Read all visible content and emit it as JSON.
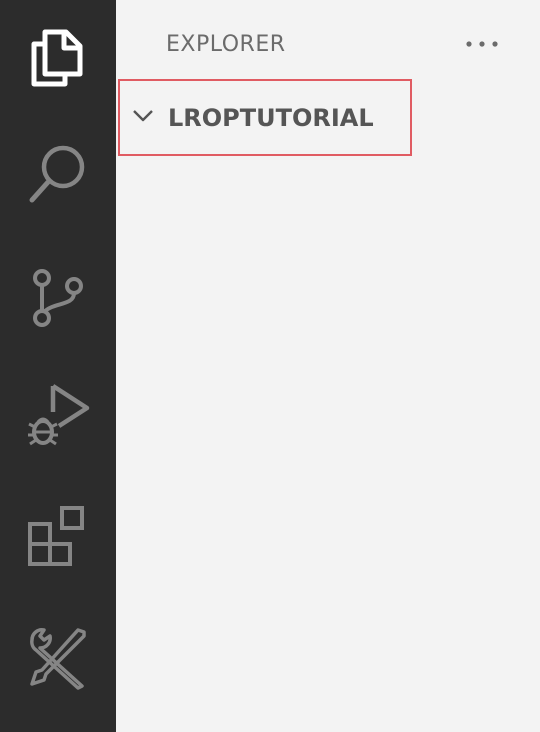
{
  "sidebar": {
    "title": "EXPLORER",
    "more_actions_label": "···",
    "folder": {
      "name": "LROPTUTORIAL",
      "expanded": true
    }
  },
  "activity_bar": {
    "items": [
      {
        "icon": "files-icon",
        "active": true
      },
      {
        "icon": "search-icon",
        "active": false
      },
      {
        "icon": "source-control-icon",
        "active": false
      },
      {
        "icon": "run-debug-icon",
        "active": false
      },
      {
        "icon": "extensions-icon",
        "active": false
      },
      {
        "icon": "tools-icon",
        "active": false
      }
    ]
  },
  "colors": {
    "activity_bar_bg": "#2c2c2c",
    "sidebar_bg": "#f3f3f3",
    "icon_active": "#ffffff",
    "icon_inactive": "#858585",
    "highlight_border": "#e05b62"
  }
}
